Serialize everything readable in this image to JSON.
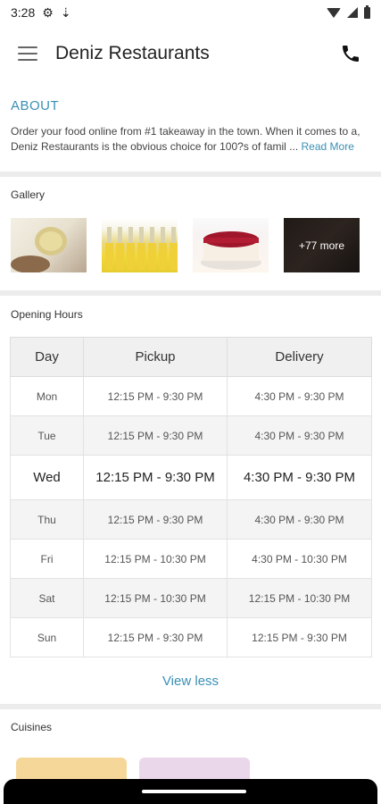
{
  "status_bar": {
    "time": "3:28"
  },
  "app_bar": {
    "title": "Deniz Restaurants",
    "menu_icon": "hamburger-menu-icon",
    "phone_icon": "phone-icon"
  },
  "about": {
    "heading": "ABOUT",
    "text": "Order your food online from #1 takeaway in the town. When it comes to a, Deniz Restaurants is the obvious choice for 100?s of famil ...",
    "read_more": "Read More"
  },
  "gallery": {
    "label": "Gallery",
    "more_label": "+77 more"
  },
  "opening_hours": {
    "label": "Opening Hours",
    "headers": [
      "Day",
      "Pickup",
      "Delivery"
    ],
    "rows": [
      {
        "day": "Mon",
        "pickup": "12:15 PM - 9:30 PM",
        "delivery": "4:30 PM - 9:30 PM"
      },
      {
        "day": "Tue",
        "pickup": "12:15 PM - 9:30 PM",
        "delivery": "4:30 PM - 9:30 PM"
      },
      {
        "day": "Wed",
        "pickup": "12:15 PM - 9:30 PM",
        "delivery": "4:30 PM - 9:30 PM"
      },
      {
        "day": "Thu",
        "pickup": "12:15 PM - 9:30 PM",
        "delivery": "4:30 PM - 9:30 PM"
      },
      {
        "day": "Fri",
        "pickup": "12:15 PM - 10:30 PM",
        "delivery": "4:30 PM - 10:30 PM"
      },
      {
        "day": "Sat",
        "pickup": "12:15 PM - 10:30 PM",
        "delivery": "12:15 PM - 10:30 PM"
      },
      {
        "day": "Sun",
        "pickup": "12:15 PM - 9:30 PM",
        "delivery": "12:15 PM - 9:30 PM"
      }
    ],
    "view_less": "View less"
  },
  "cuisines": {
    "label": "Cuisines"
  },
  "colors": {
    "accent": "#3a8fb4",
    "divider": "#ececec",
    "table_alt_row": "#f4f4f4"
  }
}
